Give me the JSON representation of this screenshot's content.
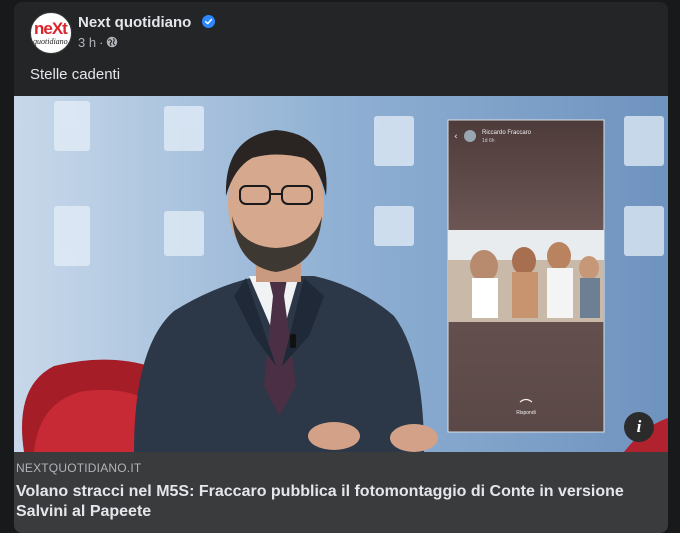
{
  "post": {
    "page_name": "Next quotidiano",
    "timestamp": "3 h",
    "separator": "·",
    "text": "Stelle cadenti",
    "avatar_text_top": "neXt",
    "avatar_text_bottom": "quotidiano"
  },
  "media": {
    "inset_username": "Riccardo Fraccaro",
    "inset_time": "1d 6h",
    "inset_reply": "Rispondi",
    "info_glyph": "i"
  },
  "link": {
    "domain": "NEXTQUOTIDIANO.IT",
    "headline": "Volano stracci nel M5S: Fraccaro pubblica il fotomontaggio di Conte in versione Salvini al Papeete"
  },
  "colors": {
    "background": "#18191a",
    "card": "#242526",
    "link_preview": "#3a3b3c",
    "verified": "#2d88ff",
    "text_primary": "#e4e6eb",
    "text_secondary": "#b0b3b8"
  },
  "icons": [
    "verified-badge-icon",
    "globe-icon",
    "info-icon"
  ]
}
